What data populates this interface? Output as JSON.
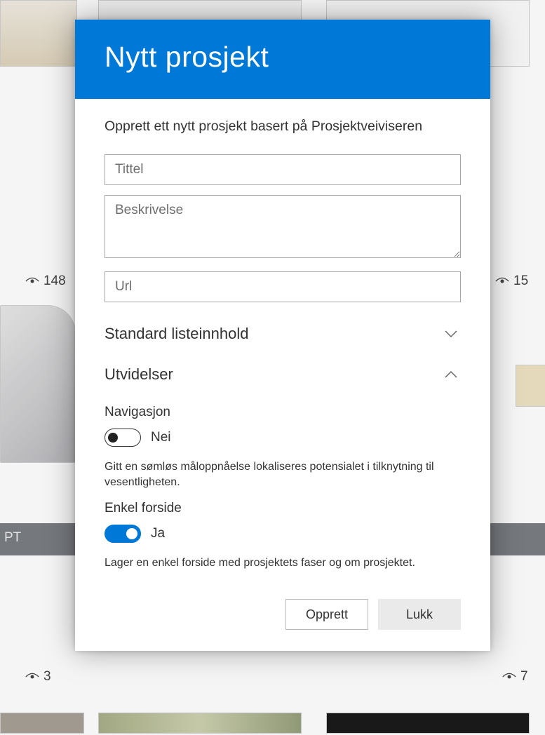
{
  "background": {
    "stats": [
      {
        "value": "148"
      },
      {
        "value": "15"
      },
      {
        "value": "3"
      },
      {
        "value": "7"
      }
    ],
    "band_text": "PT"
  },
  "dialog": {
    "title": "Nytt prosjekt",
    "intro": "Opprett ett nytt prosjekt basert på Prosjektveiviseren",
    "fields": {
      "title_placeholder": "Tittel",
      "description_placeholder": "Beskrivelse",
      "url_placeholder": "Url"
    },
    "sections": {
      "standard": "Standard listeinnhold",
      "extensions": "Utvidelser"
    },
    "settings": {
      "nav": {
        "label": "Navigasjon",
        "state_text": "Nei",
        "on": false,
        "help": "Gitt en sømløs måloppnåelse lokaliseres potensialet i tilknytning til vesentligheten."
      },
      "simple_front": {
        "label": "Enkel forside",
        "state_text": "Ja",
        "on": true,
        "help": "Lager en enkel forside med prosjektets faser og om prosjektet."
      }
    },
    "buttons": {
      "create": "Opprett",
      "close": "Lukk"
    }
  }
}
